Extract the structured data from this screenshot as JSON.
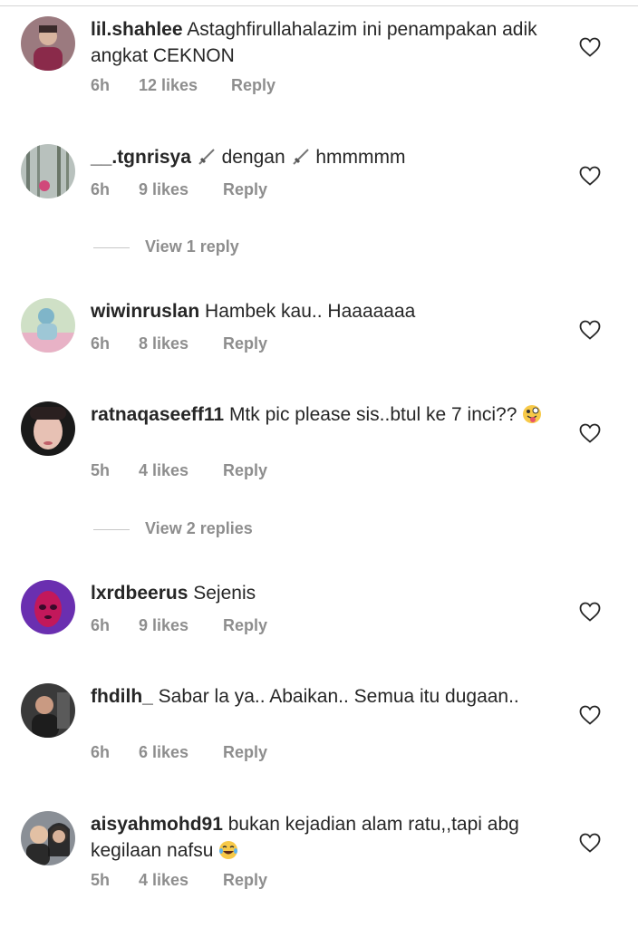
{
  "comments": [
    {
      "username": "lil.shahlee",
      "text": "Astaghfirullahalazim ini penampakan adik angkat CEKNON",
      "time": "6h",
      "likes": "12 likes",
      "reply": "Reply"
    },
    {
      "username": "__.tgnrisya",
      "text_a": "dengan",
      "text_b": "hmmmmm",
      "time": "6h",
      "likes": "9 likes",
      "reply": "Reply"
    },
    {
      "username": "wiwinruslan",
      "text": "Hambek kau.. Haaaaaaa",
      "time": "6h",
      "likes": "8 likes",
      "reply": "Reply"
    },
    {
      "username": "ratnaqaseeff11",
      "text": "Mtk pic please sis..btul ke 7 inci??",
      "time": "5h",
      "likes": "4 likes",
      "reply": "Reply"
    },
    {
      "username": "lxrdbeerus",
      "text": "Sejenis",
      "time": "6h",
      "likes": "9 likes",
      "reply": "Reply"
    },
    {
      "username": "fhdilh_",
      "text": "Sabar la ya.. Abaikan.. Semua itu dugaan..",
      "time": "6h",
      "likes": "6 likes",
      "reply": "Reply"
    },
    {
      "username": "aisyahmohd91",
      "text": "bukan kejadian alam ratu,,tapi abg kegilaan nafsu",
      "time": "5h",
      "likes": "4 likes",
      "reply": "Reply"
    }
  ],
  "view_replies": [
    "View 1 reply",
    "View 2 replies"
  ],
  "icons": {
    "like": "heart-outline-icon",
    "dagger": "dagger-emoji",
    "tongue": "zany-face-emoji",
    "laugh": "tears-of-joy-emoji"
  },
  "colors": {
    "text": "#262626",
    "meta": "#8e8e8e",
    "divider": "#c7c7c7"
  }
}
